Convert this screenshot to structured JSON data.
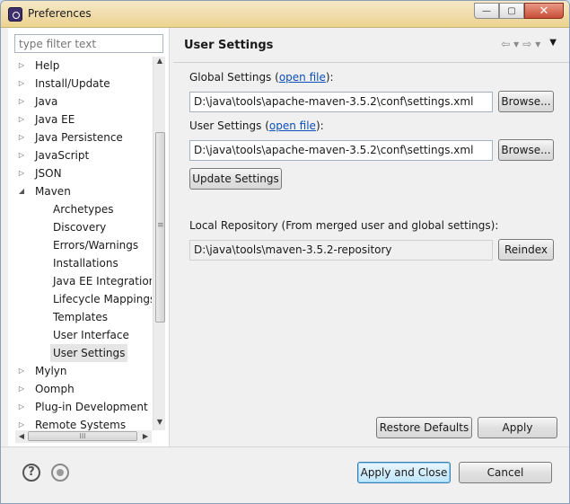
{
  "window": {
    "title": "Preferences",
    "minimize_glyph": "—",
    "maximize_glyph": "▢",
    "close_glyph": "✕"
  },
  "filter": {
    "placeholder": "type filter text",
    "value": ""
  },
  "tree": {
    "items": [
      {
        "label": "Help",
        "expander": "▷"
      },
      {
        "label": "Install/Update",
        "expander": "▷"
      },
      {
        "label": "Java",
        "expander": "▷"
      },
      {
        "label": "Java EE",
        "expander": "▷"
      },
      {
        "label": "Java Persistence",
        "expander": "▷"
      },
      {
        "label": "JavaScript",
        "expander": "▷"
      },
      {
        "label": "JSON",
        "expander": "▷"
      },
      {
        "label": "Maven",
        "expander": "◢"
      },
      {
        "label": "Archetypes"
      },
      {
        "label": "Discovery"
      },
      {
        "label": "Errors/Warnings"
      },
      {
        "label": "Installations"
      },
      {
        "label": "Java EE Integration"
      },
      {
        "label": "Lifecycle Mappings"
      },
      {
        "label": "Templates"
      },
      {
        "label": "User Interface"
      },
      {
        "label": "User Settings"
      },
      {
        "label": "Mylyn",
        "expander": "▷"
      },
      {
        "label": "Oomph",
        "expander": "▷"
      },
      {
        "label": "Plug-in Development",
        "expander": "▷"
      },
      {
        "label": "Remote Systems",
        "expander": "▷"
      }
    ],
    "selected": "User Settings"
  },
  "scrollbars": {
    "up": "▲",
    "down": "▼",
    "left": "◀",
    "right": "▶",
    "grip": "III"
  },
  "page": {
    "title": "User Settings",
    "nav": {
      "back": "⇦",
      "back_menu": "▾",
      "forward": "⇨",
      "forward_menu": "▾",
      "view_menu": "▼"
    },
    "global_label_pre": "Global Settings (",
    "global_link": "open file",
    "global_label_post": "):",
    "global_path": "D:\\java\\tools\\apache-maven-3.5.2\\conf\\settings.xml",
    "user_label_pre": "User Settings (",
    "user_link": "open file",
    "user_label_post": "):",
    "user_path": "D:\\java\\tools\\apache-maven-3.5.2\\conf\\settings.xml",
    "browse_label": "Browse...",
    "update_label": "Update Settings",
    "local_repo_label": "Local Repository (From merged user and global settings):",
    "local_repo_path": "D:\\java\\tools\\maven-3.5.2-repository",
    "reindex_label": "Reindex",
    "restore_defaults_label": "Restore Defaults",
    "apply_label": "Apply"
  },
  "footer": {
    "help_glyph": "?",
    "apply_close_label": "Apply and Close",
    "cancel_label": "Cancel"
  }
}
